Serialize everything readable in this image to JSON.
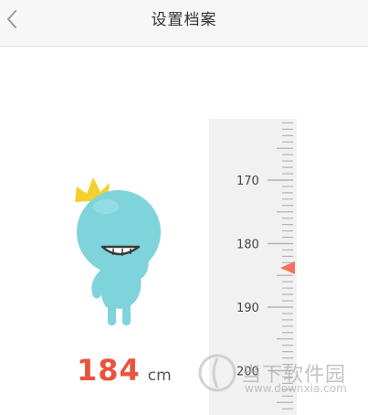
{
  "header": {
    "title": "设置档案",
    "back_icon": "chevron-left-icon"
  },
  "height": {
    "value": "184",
    "unit": "cm"
  },
  "ruler": {
    "labels": [
      "170",
      "180",
      "190",
      "200"
    ],
    "current_value": 184,
    "pointer_color": "#f2725c"
  },
  "mascot": {
    "body_color": "#7fd4dc",
    "crown_color": "#f5cf2d"
  },
  "watermark": {
    "title": "当下软件园",
    "url": "www.downxia.com"
  }
}
